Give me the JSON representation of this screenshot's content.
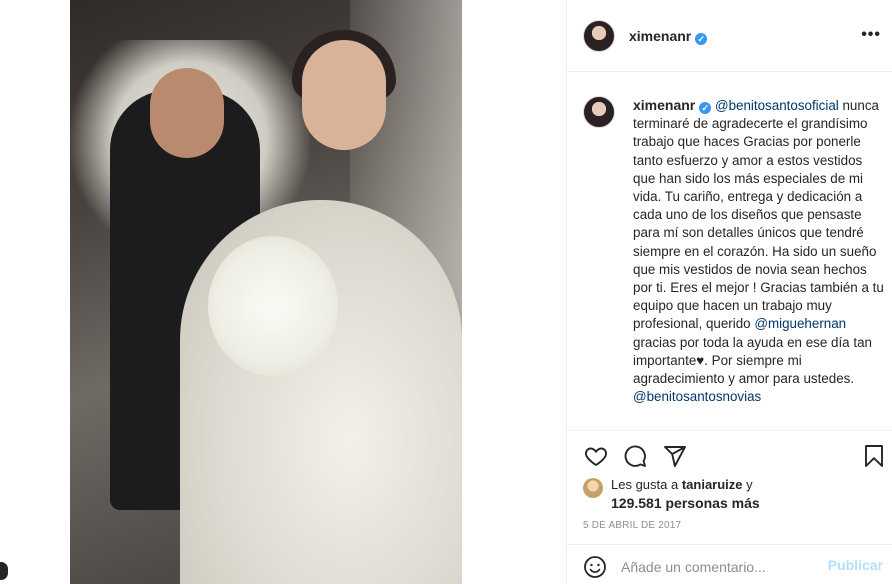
{
  "post": {
    "username": "ximenanr",
    "verified_badge": "✓",
    "more_options_label": "•••"
  },
  "caption": {
    "username": "ximenanr",
    "lead_glyphs": "",
    "mention_1": "@benitosantosoficial",
    "text_1": "nunca terminaré de agradecerte el grandísimo trabajo que haces",
    "glyphs_1": "",
    "text_2": "Gracias por ponerle tanto esfuerzo y amor a estos vestidos que han sido los más especiales de mi vida. Tu cariño, entrega y dedicación a cada uno de los diseños que pensaste para mí son detalles únicos que tendré siempre en el corazón. Ha sido un sueño que mis vestidos de novia sean hechos por ti. Eres el mejor ! Gracias también a tu equipo que hacen un trabajo muy profesional, querido",
    "mention_2": "@miguehernan",
    "text_3": "gracias por toda la ayuda en ese día tan importante",
    "heart": "♥",
    "glyphs_2": "",
    "text_4": ". Por siempre mi agradecimiento y amor para ustedes.",
    "mention_3": "@benitosantosnovias"
  },
  "actions": {
    "like_icon": "heart-outline-icon",
    "comment_icon": "comment-bubble-icon",
    "share_icon": "paper-plane-icon",
    "save_icon": "bookmark-icon"
  },
  "likes": {
    "prefix": "Les gusta a ",
    "first_user": "taniaruize",
    "suffix": " y",
    "others": "129.581 personas más"
  },
  "date": "5 DE ABRIL DE 2017",
  "add_comment": {
    "placeholder": "Añade un comentario...",
    "post_label": "Publicar",
    "emoji_icon": "smiley-icon"
  },
  "colors": {
    "text": "#262626",
    "mention": "#00376b",
    "muted": "#8e8e8e",
    "verified": "#3897f0",
    "publish_disabled": "#b2dffc"
  }
}
